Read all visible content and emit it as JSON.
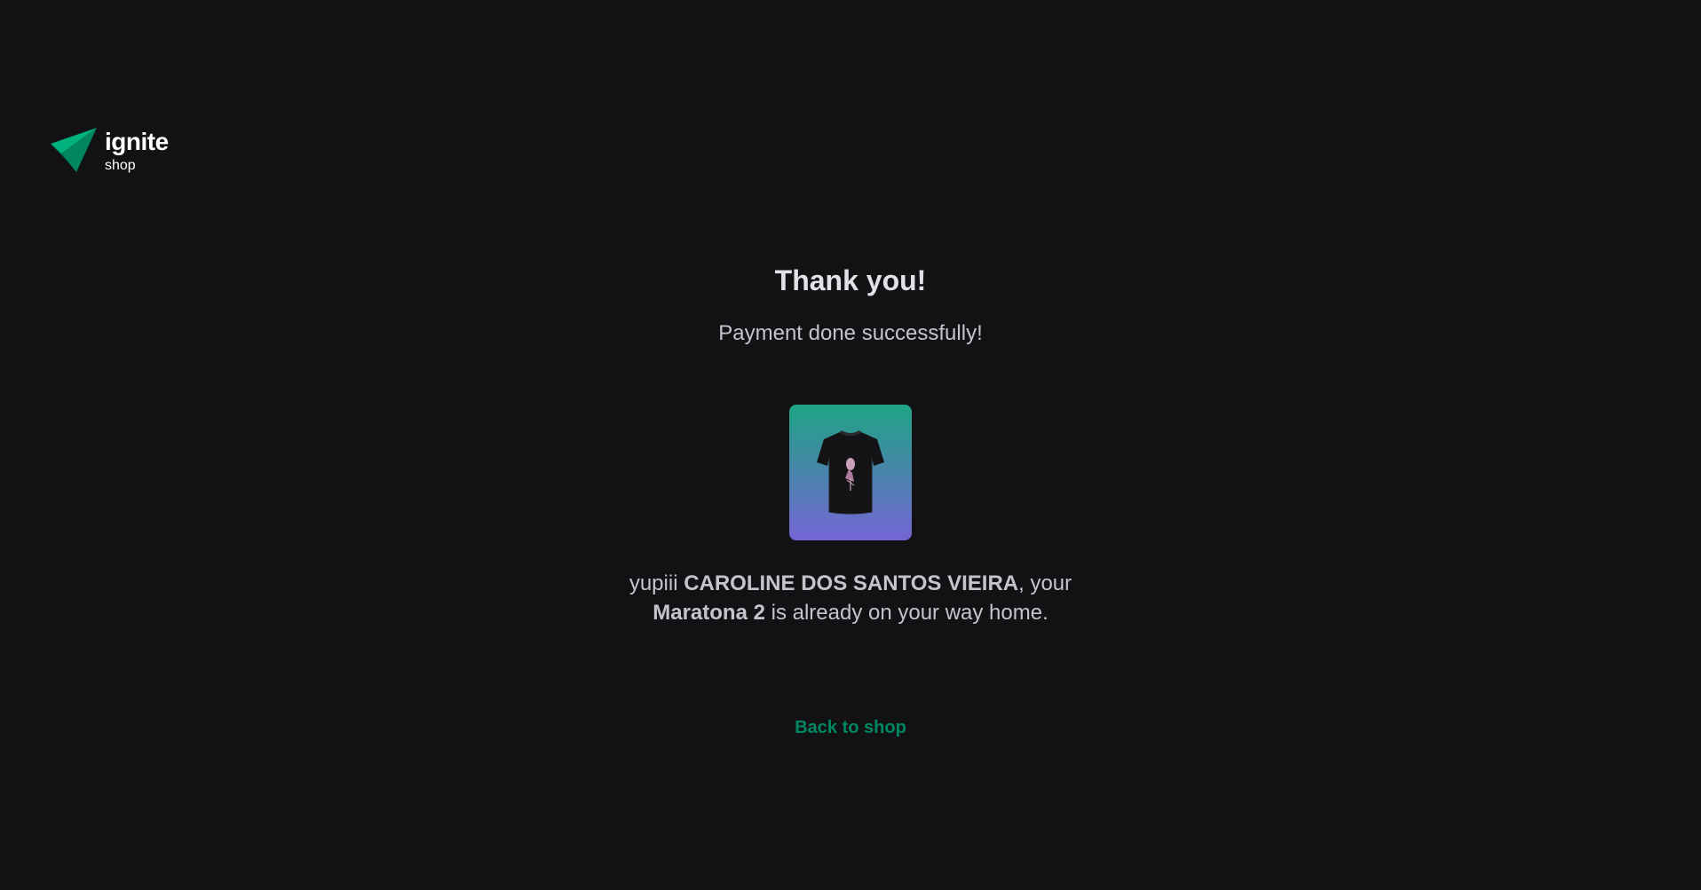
{
  "header": {
    "logo_word": "ignite",
    "logo_sub": "shop",
    "logo_icon": "paper-plane-logo-icon",
    "brand_color": "#00875f"
  },
  "success": {
    "title": "Thank you!",
    "subtitle": "Payment done successfully!",
    "product_image_icon": "t-shirt-image",
    "image_gradient": [
      "#1ea483",
      "#7465d4"
    ],
    "message_prefix": "yupiii ",
    "customer_name": "CAROLINE DOS SANTOS VIEIRA",
    "message_mid": ", your ",
    "product_name": "Maratona 2",
    "message_suffix": " is already on your way home.",
    "back_link": "Back to shop"
  }
}
